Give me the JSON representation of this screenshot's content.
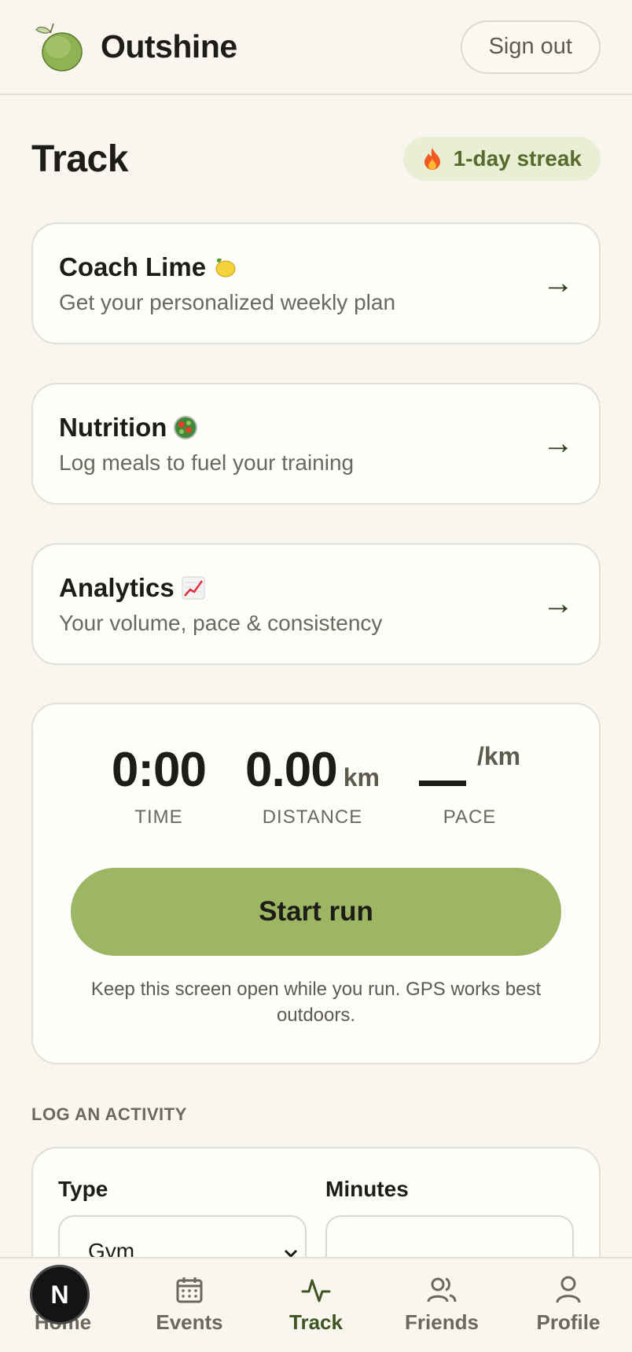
{
  "header": {
    "app_name": "Outshine",
    "logo_icon": "lime-fruit-icon",
    "signout_label": "Sign out"
  },
  "page": {
    "title": "Track",
    "streak_label": "1-day streak",
    "streak_icon": "flame-icon"
  },
  "cards": [
    {
      "title": "Coach Lime",
      "subtitle": "Get your personalized weekly plan",
      "icon": "lemon-emoji"
    },
    {
      "title": "Nutrition",
      "subtitle": "Log meals to fuel your training",
      "icon": "salad-emoji"
    },
    {
      "title": "Analytics",
      "subtitle": "Your volume, pace & consistency",
      "icon": "chart-up-emoji"
    }
  ],
  "run": {
    "time_value": "0:00",
    "time_label": "TIME",
    "distance_value": "0.00",
    "distance_unit": "km",
    "distance_label": "DISTANCE",
    "pace_unit": "/km",
    "pace_label": "PACE",
    "start_label": "Start run",
    "hint": "Keep this screen open while you run. GPS works best outdoors."
  },
  "log": {
    "section_label": "LOG AN ACTIVITY",
    "type_label": "Type",
    "type_value": "Gym",
    "minutes_label": "Minutes",
    "minutes_value": ""
  },
  "nav": {
    "items": [
      {
        "label": "Home",
        "icon": "home-icon"
      },
      {
        "label": "Events",
        "icon": "calendar-icon"
      },
      {
        "label": "Track",
        "icon": "activity-pulse-icon"
      },
      {
        "label": "Friends",
        "icon": "users-icon"
      },
      {
        "label": "Profile",
        "icon": "user-icon"
      }
    ],
    "active": "Track",
    "dev_badge": "N"
  },
  "colors": {
    "background": "#f8f6ef",
    "accent": "#9db663",
    "streak_bg": "#e9efd4",
    "active_nav": "#3f5420"
  }
}
